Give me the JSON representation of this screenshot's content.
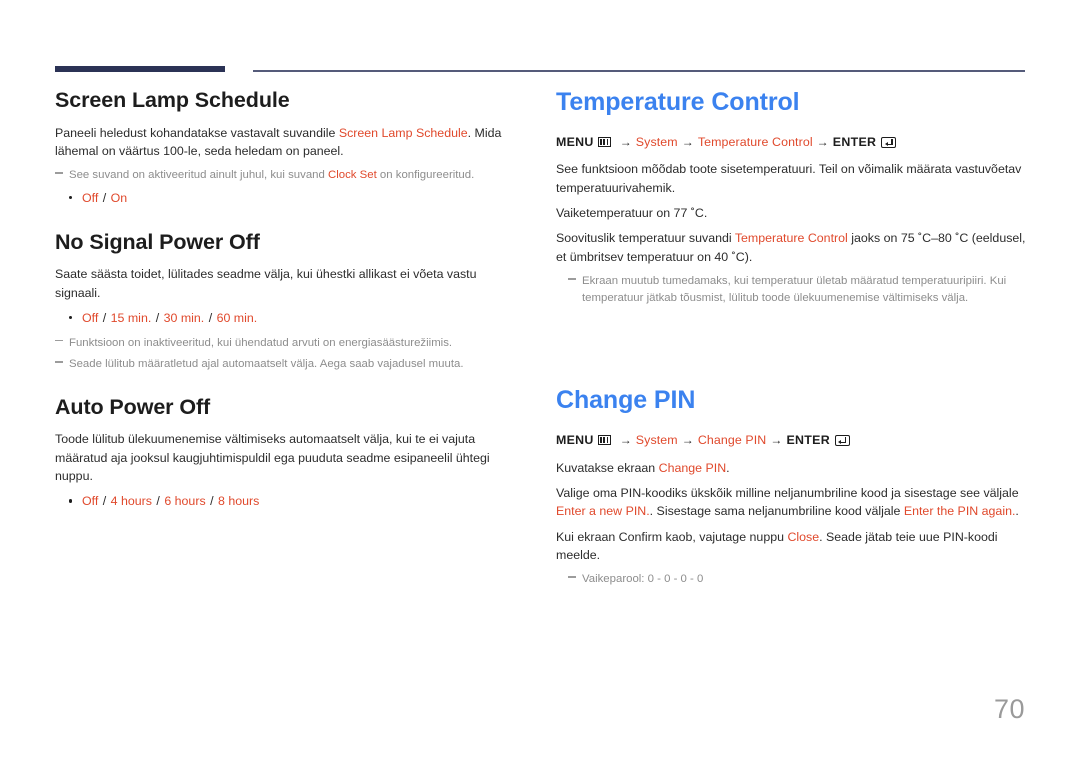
{
  "page": {
    "number": "70",
    "accent_color": "#e0492c",
    "heading_blue": "#3b82ef",
    "rule_color": "#2b3255"
  },
  "icons": {
    "menu": "menu-grid-icon",
    "enter": "enter-return-icon",
    "arrow": "→"
  },
  "left_column": {
    "sections": [
      {
        "title": "Screen Lamp Schedule",
        "paragraph_a": "Paneeli heledust kohandatakse vastavalt suvandile ",
        "paragraph_a_accent": "Screen Lamp Schedule",
        "paragraph_a_tail": ". Mida lähemal on väärtus 100-le, seda heledam on paneel.",
        "note_a": "See suvand on aktiveeritud ainult juhul, kui suvand ",
        "note_a_accent": "Clock Set",
        "note_a_tail": " on konfigureeritud.",
        "options": [
          "Off",
          "On"
        ]
      },
      {
        "title": "No Signal Power Off",
        "paragraph_a": "Saate säästa toidet, lülitades seadme välja, kui ühestki allikast ei võeta vastu signaali.",
        "options": [
          "Off",
          "15 min.",
          "30 min.",
          "60 min."
        ],
        "note_a": "Funktsioon on inaktiveeritud, kui ühendatud arvuti on energiasäästurežiimis.",
        "note_b": "Seade lülitub määratletud ajal automaatselt välja. Aega saab vajadusel muuta."
      },
      {
        "title": "Auto Power Off",
        "paragraph_a": "Toode lülitub ülekuumenemise vältimiseks automaatselt välja, kui te ei vajuta määratud aja jooksul kaugjuhtimispuldil ega puuduta seadme esipaneelil ühtegi nuppu.",
        "options": [
          "Off",
          "4 hours",
          "6 hours",
          "8 hours"
        ]
      }
    ]
  },
  "right_column": {
    "sections": [
      {
        "title": "Temperature Control",
        "menu_path": {
          "menu_label": "MENU",
          "item_1": "System",
          "item_2": "Temperature Control",
          "enter_label": "ENTER"
        },
        "paragraph_a": "See funktsioon mõõdab toote sisetemperatuuri. Teil on võimalik määrata vastuvõetav temperatuurivahemik.",
        "paragraph_b": "Vaiketemperatuur on 77 ˚C.",
        "paragraph_c_pre": "Soovituslik temperatuur suvandi ",
        "paragraph_c_accent": "Temperature Control",
        "paragraph_c_tail": " jaoks on 75 ˚C–80 ˚C (eeldusel, et ümbritsev temperatuur on 40 ˚C).",
        "note_a": "Ekraan muutub tumedamaks, kui temperatuur ületab määratud temperatuuripiiri. Kui temperatuur jätkab tõusmist, lülitub toode ülekuumenemise vältimiseks välja."
      },
      {
        "title": "Change PIN",
        "menu_path": {
          "menu_label": "MENU",
          "item_1": "System",
          "item_2": "Change PIN",
          "enter_label": "ENTER"
        },
        "paragraph_a_pre": "Kuvatakse ekraan ",
        "paragraph_a_accent": "Change PIN",
        "paragraph_a_tail": ".",
        "paragraph_b_pre": "Valige oma PIN-koodiks ükskõik milline neljanumbriline kood ja sisestage see väljale ",
        "paragraph_b_accent1": "Enter a new PIN.",
        "paragraph_b_mid": ". Sisestage sama neljanumbriline kood väljale ",
        "paragraph_b_accent2": "Enter the PIN again.",
        "paragraph_b_tail": ".",
        "paragraph_c_pre": "Kui ekraan Confirm kaob, vajutage nuppu ",
        "paragraph_c_accent": "Close",
        "paragraph_c_tail": ". Seade jätab teie uue PIN-koodi meelde.",
        "note_a": "Vaikeparool: 0 - 0 - 0 - 0"
      }
    ]
  }
}
